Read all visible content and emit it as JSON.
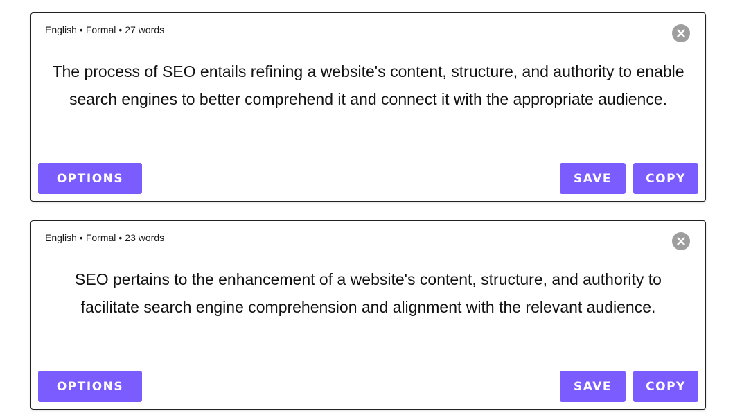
{
  "results": [
    {
      "meta": {
        "language": "English",
        "tone": "Formal",
        "word_count": "27 words",
        "separator": "•"
      },
      "text": "The process of SEO entails refining a website's content, structure, and authority to enable search engines to better comprehend it and connect it with the appropriate audience.",
      "close_icon": "close-circle-icon",
      "options_label": "OPTIONS",
      "save_label": "SAVE",
      "copy_label": "COPY"
    },
    {
      "meta": {
        "language": "English",
        "tone": "Formal",
        "word_count": "23 words",
        "separator": "•"
      },
      "text": "SEO pertains to the enhancement of a website's content, structure, and authority to facilitate search engine comprehension and alignment with the relevant audience.",
      "close_icon": "close-circle-icon",
      "options_label": "OPTIONS",
      "save_label": "SAVE",
      "copy_label": "COPY"
    }
  ],
  "colors": {
    "accent": "#7b5cff",
    "close_icon_bg": "#9e9e9e",
    "border": "#222222"
  }
}
